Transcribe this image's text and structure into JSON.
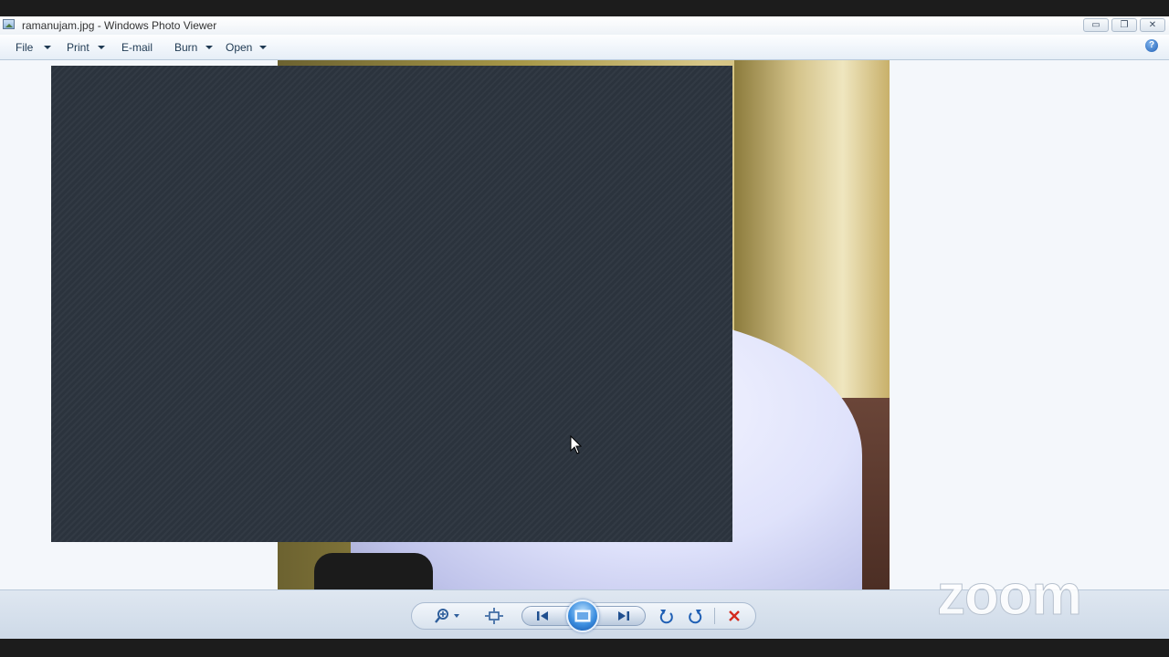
{
  "window": {
    "title": "ramanujam.jpg - Windows Photo Viewer"
  },
  "menu": {
    "file": "File",
    "print": "Print",
    "email": "E-mail",
    "burn": "Burn",
    "open": "Open"
  },
  "watermark": {
    "text": "zoom"
  },
  "colors": {
    "overlay": "#2b333d",
    "delete_red": "#d42a1e",
    "accent_blue": "#2f79d2"
  }
}
